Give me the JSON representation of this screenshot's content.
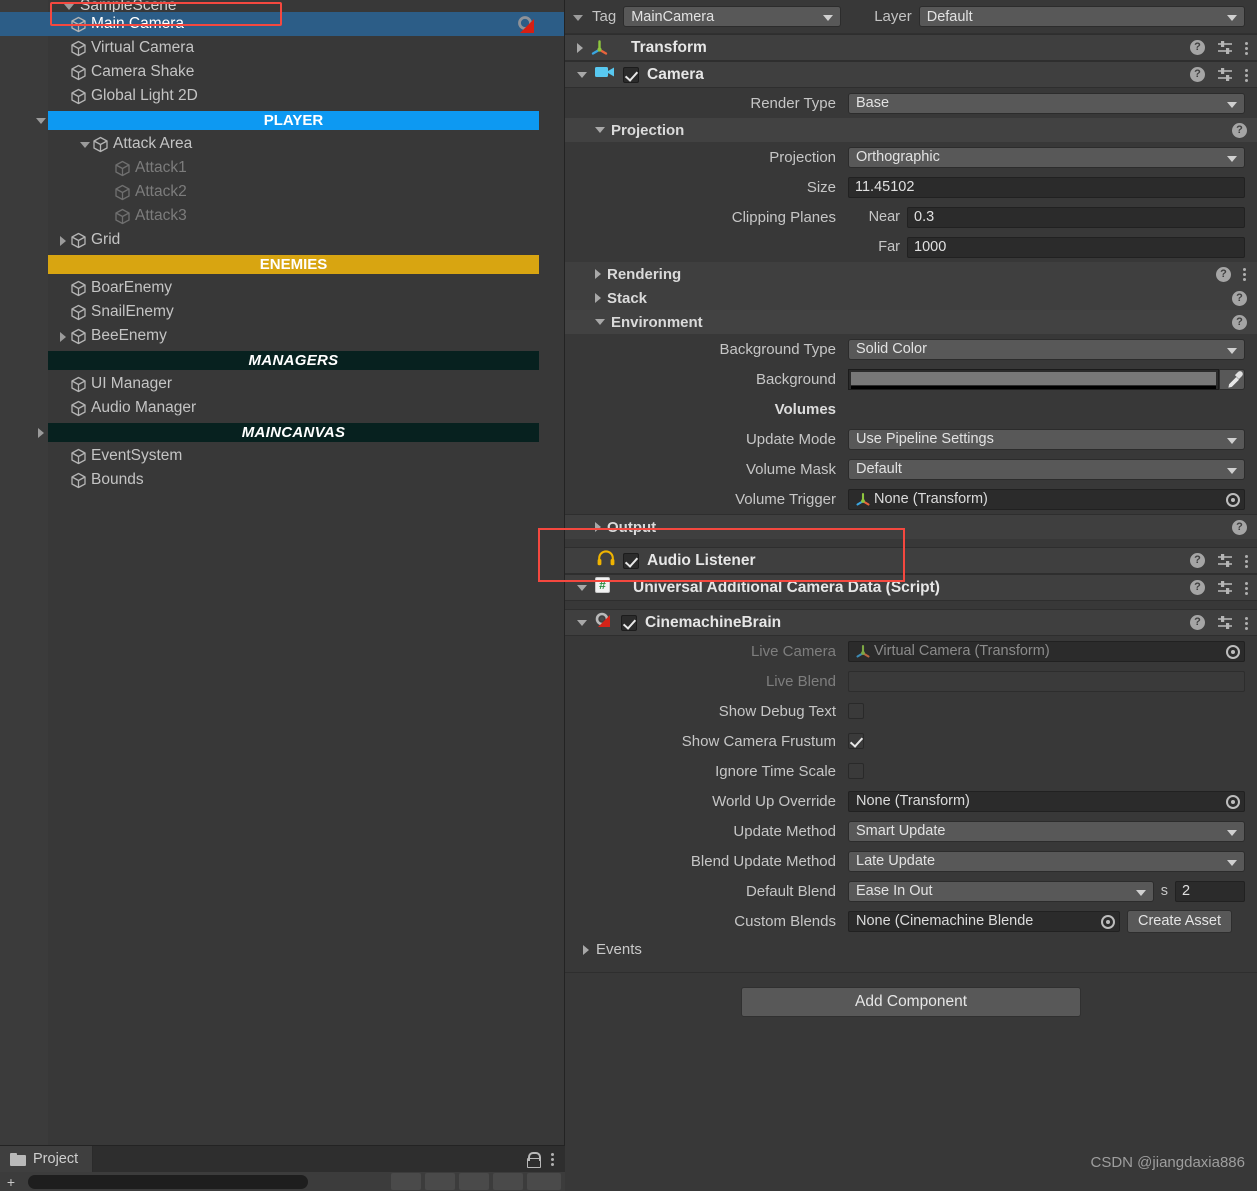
{
  "hierarchy": {
    "panel_name": "Hierarchy",
    "scene_row": {
      "label": "SampleScene"
    },
    "items": [
      {
        "label": "Main Camera",
        "type": "object",
        "indent": 2,
        "selected": true,
        "twisty": "none",
        "dim": false,
        "has_cinemachine_icon": true
      },
      {
        "label": "Virtual Camera",
        "type": "object",
        "indent": 2,
        "selected": false,
        "twisty": "none",
        "dim": false
      },
      {
        "label": "Camera Shake",
        "type": "object",
        "indent": 2,
        "selected": false,
        "twisty": "none",
        "dim": false
      },
      {
        "label": "Global Light 2D",
        "type": "object",
        "indent": 2,
        "selected": false,
        "twisty": "none",
        "dim": false
      },
      {
        "label": "PLAYER",
        "type": "banner",
        "style": "player",
        "indent": 1,
        "twisty": "down"
      },
      {
        "label": "Attack Area",
        "type": "object",
        "indent": 3,
        "selected": false,
        "twisty": "down",
        "dim": false
      },
      {
        "label": "Attack1",
        "type": "object",
        "indent": 4,
        "selected": false,
        "twisty": "none",
        "dim": true
      },
      {
        "label": "Attack2",
        "type": "object",
        "indent": 4,
        "selected": false,
        "twisty": "none",
        "dim": true
      },
      {
        "label": "Attack3",
        "type": "object",
        "indent": 4,
        "selected": false,
        "twisty": "none",
        "dim": true
      },
      {
        "label": "Grid",
        "type": "object",
        "indent": 2,
        "selected": false,
        "twisty": "right",
        "dim": false
      },
      {
        "label": "ENEMIES",
        "type": "banner",
        "style": "enemies",
        "indent": 1,
        "twisty": "none"
      },
      {
        "label": "BoarEnemy",
        "type": "object",
        "indent": 2,
        "selected": false,
        "twisty": "none",
        "dim": false
      },
      {
        "label": "SnailEnemy",
        "type": "object",
        "indent": 2,
        "selected": false,
        "twisty": "none",
        "dim": false
      },
      {
        "label": "BeeEnemy",
        "type": "object",
        "indent": 2,
        "selected": false,
        "twisty": "right",
        "dim": false
      },
      {
        "label": "MANAGERS",
        "type": "banner",
        "style": "managers",
        "indent": 1,
        "twisty": "none"
      },
      {
        "label": "UI Manager",
        "type": "object",
        "indent": 2,
        "selected": false,
        "twisty": "none",
        "dim": false
      },
      {
        "label": "Audio Manager",
        "type": "object",
        "indent": 2,
        "selected": false,
        "twisty": "none",
        "dim": false
      },
      {
        "label": "MAINCANVAS",
        "type": "banner",
        "style": "maincanvas",
        "indent": 1,
        "twisty": "right"
      },
      {
        "label": "EventSystem",
        "type": "object",
        "indent": 2,
        "selected": false,
        "twisty": "none",
        "dim": false
      },
      {
        "label": "Bounds",
        "type": "object",
        "indent": 2,
        "selected": false,
        "twisty": "none",
        "dim": false
      }
    ]
  },
  "project": {
    "tab_label": "Project",
    "folder_icon": "folder-icon",
    "lock_icon": "lock-icon",
    "menu_icon": "kebab-menu-icon",
    "search_placeholder": ""
  },
  "inspector": {
    "tag": {
      "label": "Tag",
      "value": "MainCamera"
    },
    "layer": {
      "label": "Layer",
      "value": "Default"
    },
    "components": [
      {
        "name": "Transform",
        "icon": "transform-gizmo-icon",
        "expanded": false,
        "has_checkbox": false
      },
      {
        "name": "Camera",
        "icon": "camera-icon",
        "expanded": true,
        "has_checkbox": true,
        "enabled": true
      },
      {
        "name": "Audio Listener",
        "icon": "headphones-icon",
        "expanded": false,
        "has_checkbox": true,
        "enabled": true,
        "highlighted": true
      },
      {
        "name": "Universal Additional Camera Data (Script)",
        "icon": "script-icon",
        "expanded": true,
        "has_checkbox": false
      },
      {
        "name": "CinemachineBrain",
        "icon": "cinemachine-icon",
        "expanded": true,
        "has_checkbox": true,
        "enabled": true
      }
    ],
    "camera": {
      "render_type": {
        "label": "Render Type",
        "value": "Base"
      },
      "projection_section": "Projection",
      "projection": {
        "label": "Projection",
        "value": "Orthographic"
      },
      "size": {
        "label": "Size",
        "value": "11.45102"
      },
      "clipping_planes": {
        "label": "Clipping Planes",
        "near_label": "Near",
        "near": "0.3",
        "far_label": "Far",
        "far": "1000"
      },
      "rendering_section": "Rendering",
      "stack_section": "Stack",
      "environment_section": "Environment",
      "background_type": {
        "label": "Background Type",
        "value": "Solid Color"
      },
      "background": {
        "label": "Background",
        "color": "#787878"
      },
      "volumes_label": "Volumes",
      "update_mode": {
        "label": "Update Mode",
        "value": "Use Pipeline Settings"
      },
      "volume_mask": {
        "label": "Volume Mask",
        "value": "Default"
      },
      "volume_trigger": {
        "label": "Volume Trigger",
        "value": "None (Transform)"
      },
      "output_section": "Output"
    },
    "cinemachine": {
      "live_camera": {
        "label": "Live Camera",
        "value": "Virtual Camera (Transform)"
      },
      "live_blend": {
        "label": "Live Blend",
        "value": ""
      },
      "show_debug_text": {
        "label": "Show Debug Text",
        "checked": false
      },
      "show_camera_frustum": {
        "label": "Show Camera Frustum",
        "checked": true
      },
      "ignore_time_scale": {
        "label": "Ignore Time Scale",
        "checked": false
      },
      "world_up_override": {
        "label": "World Up Override",
        "value": "None (Transform)"
      },
      "update_method": {
        "label": "Update Method",
        "value": "Smart Update"
      },
      "blend_update_method": {
        "label": "Blend Update Method",
        "value": "Late Update"
      },
      "default_blend": {
        "label": "Default Blend",
        "value": "Ease In Out",
        "unit": "s",
        "seconds": "2"
      },
      "custom_blends": {
        "label": "Custom Blends",
        "value": "None (Cinemachine Blende",
        "button": "Create Asset"
      },
      "events_section": "Events"
    },
    "add_component": "Add Component",
    "watermark": "CSDN @jiangdaxia886"
  },
  "colors": {
    "selection_blue": "#2c5d87",
    "player_banner": "#0d99f2",
    "enemies_banner": "#d8a511",
    "managers_banner": "#07211f",
    "highlight_red": "#f4483f",
    "panel_bg": "#383838"
  }
}
